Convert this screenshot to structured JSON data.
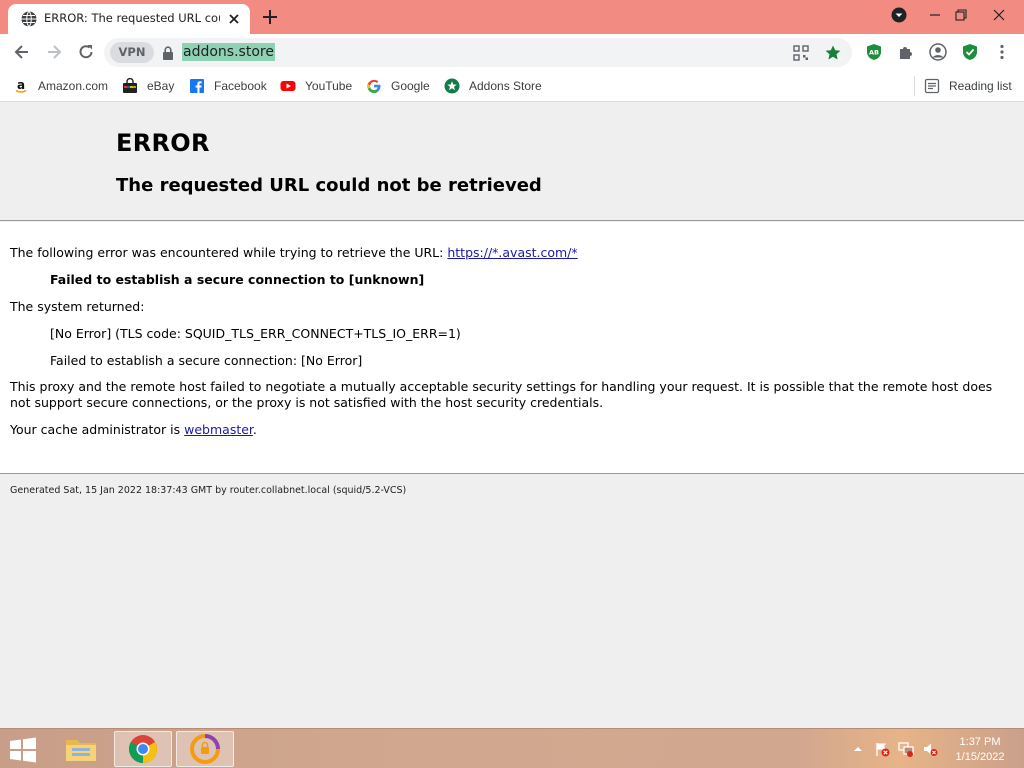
{
  "browser": {
    "tab": {
      "title": "ERROR: The requested URL could not be retrieved"
    },
    "omnibox": {
      "vpn_label": "VPN",
      "url": "addons.store"
    },
    "bookmarks": [
      {
        "label": "Amazon.com",
        "icon": "amazon-icon"
      },
      {
        "label": "eBay",
        "icon": "ebay-icon"
      },
      {
        "label": "Facebook",
        "icon": "facebook-icon"
      },
      {
        "label": "YouTube",
        "icon": "youtube-icon"
      },
      {
        "label": "Google",
        "icon": "google-icon"
      },
      {
        "label": "Addons Store",
        "icon": "addons-store-icon"
      }
    ],
    "reading_list": "Reading list"
  },
  "page": {
    "heading": "ERROR",
    "subheading": "The requested URL could not be retrieved",
    "intro": "The following error was encountered while trying to retrieve the URL:",
    "intro_link": "https://*.avast.com/*",
    "failure": "Failed to establish a secure connection to [unknown]",
    "system_returned": "The system returned:",
    "tls_code": "[No Error] (TLS code: SQUID_TLS_ERR_CONNECT+TLS_IO_ERR=1)",
    "secure_fail": "Failed to establish a secure connection: [No Error]",
    "explanation": "This proxy and the remote host failed to negotiate a mutually acceptable security settings for handling your request. It is possible that the remote host does not support secure connections, or the proxy is not satisfied with the host security credentials.",
    "admin_prefix": "Your cache administrator is",
    "admin_link": "webmaster",
    "admin_suffix": ".",
    "footer": "Generated Sat, 15 Jan 2022 18:37:43 GMT by router.collabnet.local (squid/5.2-VCS)"
  },
  "taskbar": {
    "time": "1:37 PM",
    "date": "1/15/2022"
  },
  "colors": {
    "tab_strip": "#f28b82",
    "url_highlight": "#8fd1b3",
    "link": "#1a1aa6"
  }
}
